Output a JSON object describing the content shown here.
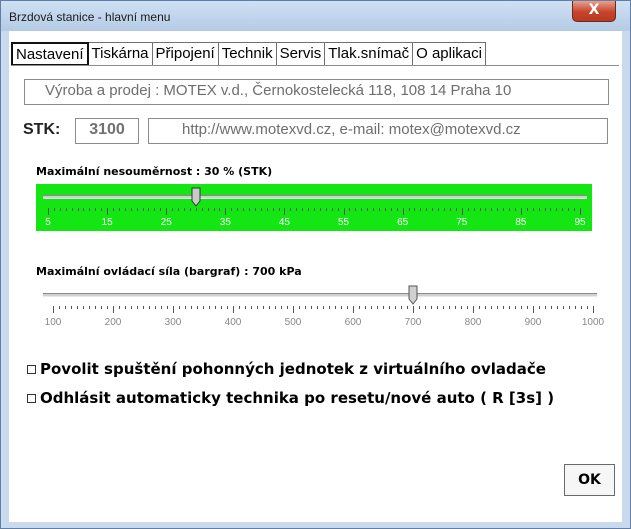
{
  "window": {
    "title": "Brzdová stanice - hlavní menu",
    "close_symbol": "X"
  },
  "tabs": [
    {
      "label": "Nastavení",
      "active": true
    },
    {
      "label": "Tiskárna",
      "active": false
    },
    {
      "label": "Připojení",
      "active": false
    },
    {
      "label": "Technik",
      "active": false
    },
    {
      "label": "Servis",
      "active": false
    },
    {
      "label": "Tlak.snímač",
      "active": false
    },
    {
      "label": "O aplikaci",
      "active": false
    }
  ],
  "info": {
    "company": "Výroba a prodej : MOTEX v.d., Černokostelecká 118, 108 14  Praha 10",
    "stk_label": "STK:",
    "stk_value": "3100",
    "contact": "http://www.motexvd.cz, e-mail: motex@motexvd.cz"
  },
  "slider_imbalance": {
    "label": "Maximální nesouměrnost : 30 % (STK)",
    "min": 5,
    "max": 95,
    "value": 30,
    "tick_labels": [
      "5",
      "15",
      "25",
      "35",
      "45",
      "55",
      "65",
      "75",
      "85",
      "95"
    ],
    "background_color": "#14e614",
    "label_color": "#ffffff"
  },
  "slider_force": {
    "label": "Maximální ovládací síla (bargraf) : 700 kPa",
    "min": 100,
    "max": 1000,
    "value": 700,
    "tick_labels": [
      "100",
      "200",
      "300",
      "400",
      "500",
      "600",
      "700",
      "800",
      "900",
      "1000"
    ],
    "label_color": "#888888"
  },
  "options": [
    {
      "label": "Povolit spuštění pohonných jednotek z virtuálního ovladače",
      "checked": false
    },
    {
      "label": "Odhlásit automaticky technika po resetu/nové auto ( R [3s] )",
      "checked": false
    }
  ],
  "ok_label": "OK"
}
